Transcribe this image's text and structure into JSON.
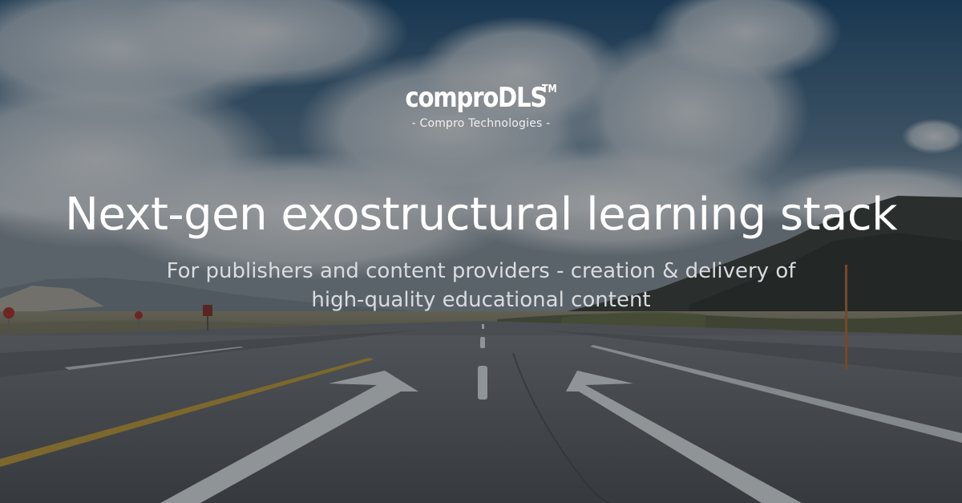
{
  "brand": {
    "name": "comproDLS",
    "trademark": "TM",
    "tagline": "- Compro Technologies -"
  },
  "hero": {
    "headline": "Next-gen exostructural learning stack",
    "subheadline_line1": "For publishers and content providers - creation & delivery of",
    "subheadline_line2": "high-quality educational content"
  },
  "background": {
    "description_icon": "road-landscape-image"
  },
  "colors": {
    "text_primary": "#ffffff",
    "text_secondary": "#d9dcdf",
    "sky": "#3e5f7d",
    "road": "#4a4d50",
    "road_marking": "#e9eef0",
    "centerline_yellow": "#c9a23a"
  }
}
